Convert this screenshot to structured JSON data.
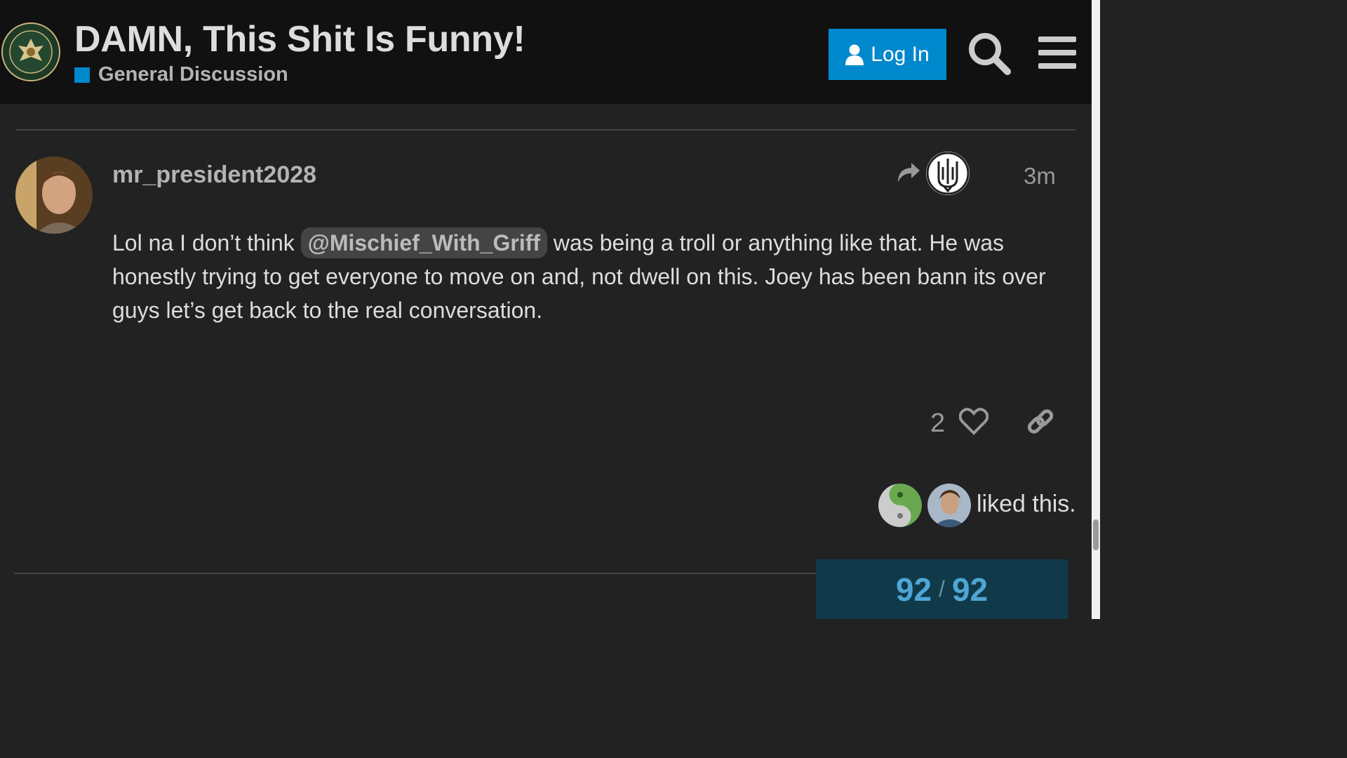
{
  "header": {
    "title": "DAMN, This Shit Is Funny!",
    "category": "General Discussion",
    "category_color": "#0088cc",
    "login_label": "Log In",
    "logo_icon": "infowars-army-seal-icon",
    "search_icon": "search-icon",
    "menu_icon": "hamburger-menu-icon"
  },
  "post": {
    "username": "mr_president2028",
    "timestamp": "3m",
    "body_before": "Lol na I don’t think ",
    "mention": "@Mischief_With_Griff",
    "body_after": " was being a troll or anything like that. He was honestly trying to get everyone to move on and, not dwell on this. Joey has been bann its over guys let’s get back to the real conversation.",
    "like_count": "2",
    "liked_text": "liked this."
  },
  "progress": {
    "current": "92",
    "separator": "/",
    "total": "92"
  },
  "colors": {
    "background": "#222222",
    "header": "#111111",
    "accent": "#0088cc"
  }
}
